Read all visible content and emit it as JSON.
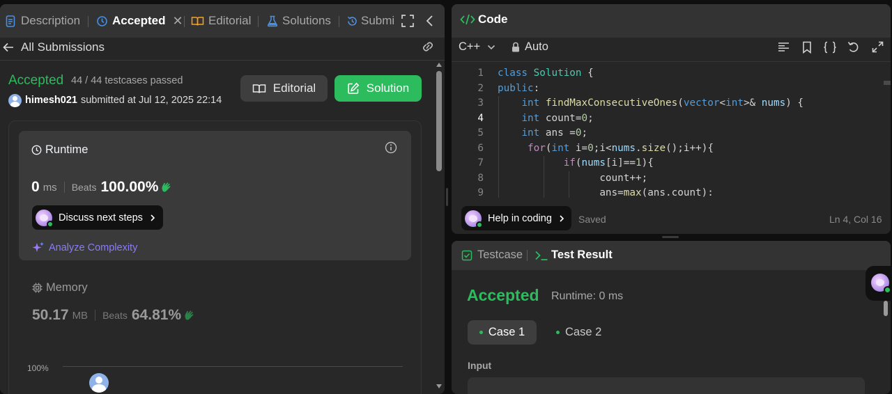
{
  "left_tabs": {
    "description": "Description",
    "accepted": "Accepted",
    "editorial": "Editorial",
    "solutions": "Solutions",
    "submissions": "Submi"
  },
  "submissions_nav": {
    "back_label": "All Submissions"
  },
  "result": {
    "status": "Accepted",
    "testcases": "44 / 44 testcases passed",
    "username": "himesh021",
    "submitted": "submitted at Jul 12, 2025 22:14",
    "editorial_button": "Editorial",
    "solution_button": "Solution"
  },
  "runtime": {
    "title": "Runtime",
    "value": "0",
    "unit": "ms",
    "beats_label": "Beats",
    "beats_value": "100.00%",
    "discuss_label": "Discuss next steps",
    "analyze_label": "Analyze Complexity"
  },
  "memory": {
    "title": "Memory",
    "value": "50.17",
    "unit": "MB",
    "beats_label": "Beats",
    "beats_value": "64.81%",
    "chart_tick": "100%"
  },
  "code_panel": {
    "title": "Code",
    "language": "C++",
    "mode": "Auto",
    "help_label": "Help in coding",
    "saved_label": "Saved",
    "cursor_pos": "Ln 4, Col 16",
    "line_numbers": [
      "1",
      "2",
      "3",
      "4",
      "5",
      "6",
      "7",
      "8",
      "9"
    ],
    "lines": [
      "class Solution {",
      "public:",
      "    int findMaxConsecutiveOnes(vector<int>& nums) {",
      "    int count=0;",
      "    int ans =0;",
      "     for(int i=0;i<nums.size();i++){",
      "           if(nums[i]==1){",
      "                 count++;",
      "                 ans=max(ans.count):"
    ]
  },
  "test_panel": {
    "testcase_tab": "Testcase",
    "result_tab": "Test Result",
    "status": "Accepted",
    "runtime": "Runtime: 0 ms",
    "case1": "Case 1",
    "case2": "Case 2",
    "input_label": "Input"
  },
  "colors": {
    "accepted_green": "#2cbb5d",
    "accent_blue": "#3b82f6",
    "panel_bg": "#262626",
    "header_bg": "#333333"
  }
}
